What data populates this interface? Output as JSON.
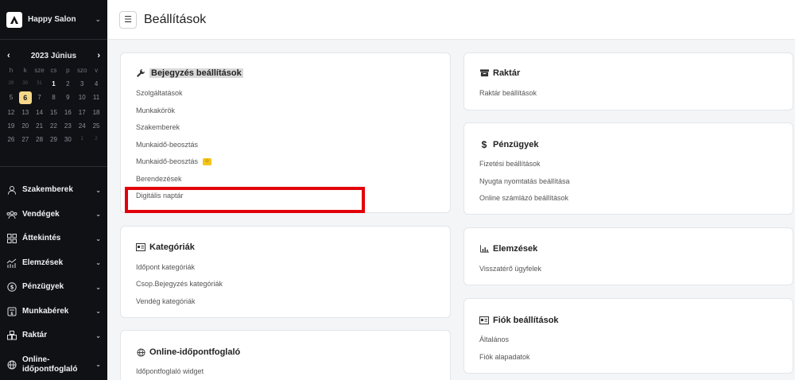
{
  "brand": {
    "name": "Happy Salon"
  },
  "calendar": {
    "title": "2023 Június",
    "dows": [
      "h",
      "k",
      "sze",
      "cs",
      "p",
      "szo",
      "v"
    ],
    "weeks": [
      [
        {
          "d": "29",
          "t": "other"
        },
        {
          "d": "30",
          "t": "other"
        },
        {
          "d": "31",
          "t": "other"
        },
        {
          "d": "1",
          "t": "first"
        },
        {
          "d": "2",
          "t": "cur"
        },
        {
          "d": "3",
          "t": "cur"
        },
        {
          "d": "4",
          "t": "cur"
        }
      ],
      [
        {
          "d": "5",
          "t": "cur"
        },
        {
          "d": "6",
          "t": "today"
        },
        {
          "d": "7",
          "t": "cur"
        },
        {
          "d": "8",
          "t": "cur"
        },
        {
          "d": "9",
          "t": "cur"
        },
        {
          "d": "10",
          "t": "cur"
        },
        {
          "d": "11",
          "t": "cur"
        }
      ],
      [
        {
          "d": "12",
          "t": "cur"
        },
        {
          "d": "13",
          "t": "cur"
        },
        {
          "d": "14",
          "t": "cur"
        },
        {
          "d": "15",
          "t": "cur"
        },
        {
          "d": "16",
          "t": "cur"
        },
        {
          "d": "17",
          "t": "cur"
        },
        {
          "d": "18",
          "t": "cur"
        }
      ],
      [
        {
          "d": "19",
          "t": "cur"
        },
        {
          "d": "20",
          "t": "cur"
        },
        {
          "d": "21",
          "t": "cur"
        },
        {
          "d": "22",
          "t": "cur"
        },
        {
          "d": "23",
          "t": "cur"
        },
        {
          "d": "24",
          "t": "cur"
        },
        {
          "d": "25",
          "t": "cur"
        }
      ],
      [
        {
          "d": "26",
          "t": "cur"
        },
        {
          "d": "27",
          "t": "cur"
        },
        {
          "d": "28",
          "t": "cur"
        },
        {
          "d": "29",
          "t": "cur"
        },
        {
          "d": "30",
          "t": "cur"
        },
        {
          "d": "1",
          "t": "other"
        },
        {
          "d": "2",
          "t": "other"
        }
      ]
    ]
  },
  "nav": [
    {
      "label": "Szakemberek",
      "icon": "person-icon"
    },
    {
      "label": "Vendégek",
      "icon": "group-icon"
    },
    {
      "label": "Áttekintés",
      "icon": "grid-icon"
    },
    {
      "label": "Elemzések",
      "icon": "analytics-icon"
    },
    {
      "label": "Pénzügyek",
      "icon": "dollar-circle-icon"
    },
    {
      "label": "Munkabérek",
      "icon": "payroll-icon"
    },
    {
      "label": "Raktár",
      "icon": "warehouse-icon"
    },
    {
      "label": "Online-\nidőpontfoglaló",
      "icon": "globe-icon"
    }
  ],
  "header": {
    "title": "Beállítások",
    "menu_icon": "hamburger-icon"
  },
  "cards": {
    "bejegyzes": {
      "title": "Bejegyzés beállítások",
      "icon": "wrench-icon",
      "links": [
        "Szolgáltatások",
        "Munkakörök",
        "Szakemberek",
        "Munkaidő-beosztás",
        "Munkaidő-beosztás",
        "Berendezések",
        "Digitális naptár"
      ],
      "emoji_icon": "smiley-emoji-icon"
    },
    "kategoriak": {
      "title": "Kategóriák",
      "icon": "id-card-icon",
      "links": [
        "Időpont kategóriák",
        "Csop.Bejegyzés kategóriák",
        "Vendég kategóriák"
      ]
    },
    "online": {
      "title": "Online-időpontfoglaló",
      "icon": "globe-icon",
      "links": [
        "Időpontfoglaló widget"
      ]
    },
    "raktar": {
      "title": "Raktár",
      "icon": "box-icon",
      "links": [
        "Raktár beállítások"
      ]
    },
    "penzugyek": {
      "title": "Pénzügyek",
      "icon": "dollar-icon",
      "links": [
        "Fizetési beállítások",
        "Nyugta nyomtatás beállítása",
        "Online számlázó beállítások"
      ]
    },
    "elemzesek": {
      "title": "Elemzések",
      "icon": "bar-chart-icon",
      "links": [
        "Visszatérő ügyfelek"
      ]
    },
    "fiok": {
      "title": "Fiók beállítások",
      "icon": "id-card-icon",
      "links": [
        "Általános",
        "Fiók alapadatok"
      ]
    }
  },
  "colors": {
    "sidebar": "#0f1115",
    "today": "#f6d889",
    "highlight_box": "#e3000b"
  }
}
